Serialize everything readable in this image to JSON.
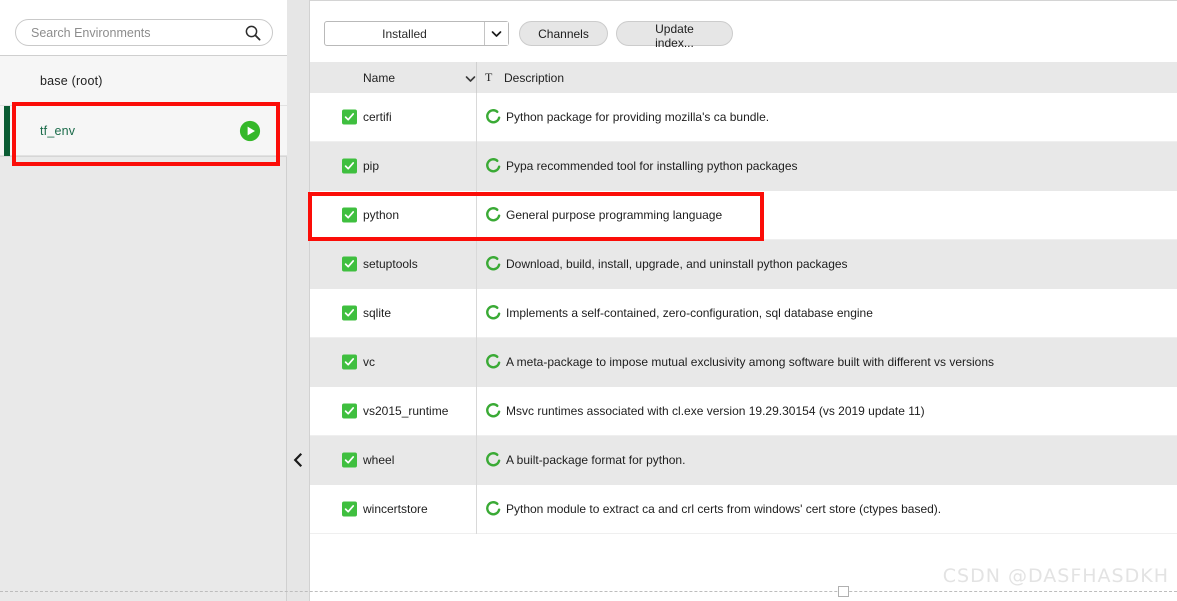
{
  "environments": {
    "search": {
      "placeholder": "Search Environments"
    },
    "search_icon": "search-icon",
    "items": [
      {
        "name": "base (root)",
        "selected": false,
        "has_play": false
      },
      {
        "name": "tf_env",
        "selected": true,
        "has_play": true,
        "play_icon": "play-icon"
      }
    ]
  },
  "splitter": {
    "collapse_icon": "chevron-left-icon"
  },
  "packages_toolbar": {
    "filter_value": "Installed",
    "filter_arrow_icon": "chevron-down-icon",
    "channels_label": "Channels",
    "update_index_label": "Update index..."
  },
  "packages_table": {
    "columns": {
      "name": "Name",
      "sort_icon": "chevron-down-icon",
      "type_icon": "T",
      "description": "Description"
    },
    "rows": [
      {
        "checked": true,
        "name": "certifi",
        "status_icon": "installed-ring-icon",
        "description": "Python package for providing mozilla's ca bundle."
      },
      {
        "checked": true,
        "name": "pip",
        "status_icon": "installed-ring-icon",
        "description": "Pypa recommended tool for installing python packages"
      },
      {
        "checked": true,
        "name": "python",
        "status_icon": "installed-ring-icon",
        "description": "General purpose programming language"
      },
      {
        "checked": true,
        "name": "setuptools",
        "status_icon": "installed-ring-icon",
        "description": "Download, build, install, upgrade, and uninstall python packages"
      },
      {
        "checked": true,
        "name": "sqlite",
        "status_icon": "installed-ring-icon",
        "description": "Implements a self-contained, zero-configuration, sql database engine"
      },
      {
        "checked": true,
        "name": "vc",
        "status_icon": "installed-ring-icon",
        "description": "A meta-package to impose mutual exclusivity among software built with different vs versions"
      },
      {
        "checked": true,
        "name": "vs2015_runtime",
        "status_icon": "installed-ring-icon",
        "description": "Msvc runtimes associated with cl.exe version 19.29.30154 (vs 2019 update 11)"
      },
      {
        "checked": true,
        "name": "wheel",
        "status_icon": "installed-ring-icon",
        "description": "A built-package format for python."
      },
      {
        "checked": true,
        "name": "wincertstore",
        "status_icon": "installed-ring-icon",
        "description": "Python module to extract ca and crl certs from windows' cert store (ctypes based)."
      }
    ]
  },
  "annotations": {
    "color": "#fb0d08",
    "boxes": [
      {
        "target": "tf_env environment row"
      },
      {
        "target": "python package row"
      }
    ]
  },
  "footer": {
    "watermark": "CSDN @DASFHASDKH"
  }
}
